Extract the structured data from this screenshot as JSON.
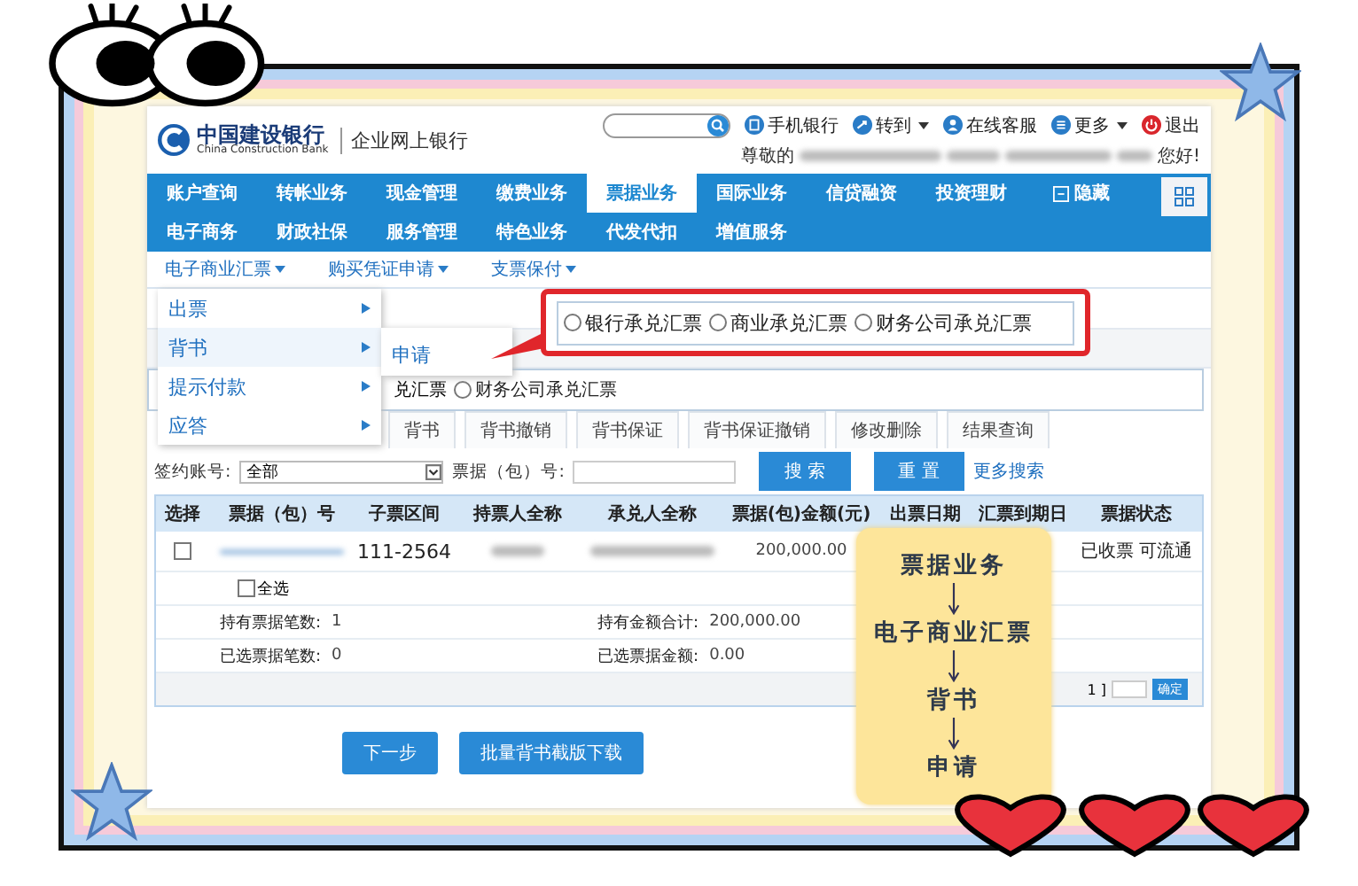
{
  "header": {
    "logo_cn": "中国建设银行",
    "logo_en": "China Construction Bank",
    "product": "企业网上银行",
    "links": [
      {
        "label": "手机银行",
        "kind": "phone",
        "dropdown": false
      },
      {
        "label": "转到",
        "kind": "goto",
        "dropdown": true
      },
      {
        "label": "在线客服",
        "kind": "service",
        "dropdown": false
      },
      {
        "label": "更多",
        "kind": "more",
        "dropdown": true
      },
      {
        "label": "退出",
        "kind": "logout",
        "dropdown": false
      }
    ],
    "greeting": {
      "prefix": "尊敬的",
      "suffix": "您好!"
    }
  },
  "nav": [
    [
      {
        "label": "账户查询",
        "selected": false,
        "has_icon": false
      },
      {
        "label": "转帐业务",
        "selected": false,
        "has_icon": false
      },
      {
        "label": "现金管理",
        "selected": false,
        "has_icon": false
      },
      {
        "label": "缴费业务",
        "selected": false,
        "has_icon": false
      },
      {
        "label": "票据业务",
        "selected": true,
        "has_icon": false
      },
      {
        "label": "国际业务",
        "selected": false,
        "has_icon": false
      },
      {
        "label": "信贷融资",
        "selected": false,
        "has_icon": false
      },
      {
        "label": "投资理财",
        "selected": false,
        "has_icon": false
      },
      {
        "label": "隐藏",
        "selected": false,
        "has_icon": true
      }
    ],
    [
      {
        "label": "电子商务",
        "selected": false,
        "has_icon": false
      },
      {
        "label": "财政社保",
        "selected": false,
        "has_icon": false
      },
      {
        "label": "服务管理",
        "selected": false,
        "has_icon": false
      },
      {
        "label": "特色业务",
        "selected": false,
        "has_icon": false
      },
      {
        "label": "代发代扣",
        "selected": false,
        "has_icon": false
      },
      {
        "label": "增值服务",
        "selected": false,
        "has_icon": false
      }
    ]
  ],
  "submenu": [
    {
      "label": "电子商业汇票",
      "dropdown": true
    },
    {
      "label": "购买凭证申请",
      "dropdown": true
    },
    {
      "label": "支票保付",
      "dropdown": true
    }
  ],
  "dropdown_menu": [
    {
      "label": "出票",
      "expanded": false
    },
    {
      "label": "背书",
      "expanded": true,
      "children": [
        {
          "label": "申请"
        }
      ]
    },
    {
      "label": "提示付款",
      "expanded": false
    },
    {
      "label": "应答",
      "expanded": false
    }
  ],
  "partial_row": {
    "fragment": "兑汇票",
    "options": [
      {
        "label": "财务公司承兑汇票",
        "selected": false
      }
    ]
  },
  "callout": {
    "options": [
      {
        "label": "银行承兑汇票",
        "selected": false
      },
      {
        "label": "商业承兑汇票",
        "selected": false
      },
      {
        "label": "财务公司承兑汇票",
        "selected": false
      }
    ]
  },
  "tabs": [
    {
      "label": "背书",
      "selected": false
    },
    {
      "label": "背书撤销",
      "selected": false
    },
    {
      "label": "背书保证",
      "selected": false
    },
    {
      "label": "背书保证撤销",
      "selected": false
    },
    {
      "label": "修改删除",
      "selected": false
    },
    {
      "label": "结果查询",
      "selected": false
    }
  ],
  "search": {
    "account_label": "签约账号:",
    "account_value": "全部",
    "bill_label": "票据（包）号:",
    "buttons": [
      "搜 索",
      "重 置"
    ],
    "more_link": "更多搜索"
  },
  "table": {
    "columns": [
      "选择",
      "票据（包）号",
      "子票区间",
      "持票人全称",
      "承兑人全称",
      "票据(包)金额(元)",
      "出票日期",
      "汇票到期日",
      "票据状态"
    ],
    "rows": [
      {
        "checked": false,
        "sub_range": "111-2564",
        "amount": "200,000.00",
        "status": "已收票 可流通"
      }
    ]
  },
  "select_all": {
    "label": "全选",
    "checked": false
  },
  "summary": [
    {
      "label": "持有票据笔数:",
      "value": "1"
    },
    {
      "label": "持有金额合计:",
      "value": "200,000.00"
    },
    {
      "label": "已选票据笔数:",
      "value": "0"
    },
    {
      "label": "已选票据金额:",
      "value": "0.00"
    }
  ],
  "pagination": {
    "text": "1 ]",
    "button": "确定"
  },
  "actions": [
    "下一步",
    "批量背书截版下载"
  ],
  "note": {
    "steps": [
      "票据业务",
      "电子商业汇票",
      "背书",
      "申请"
    ]
  }
}
